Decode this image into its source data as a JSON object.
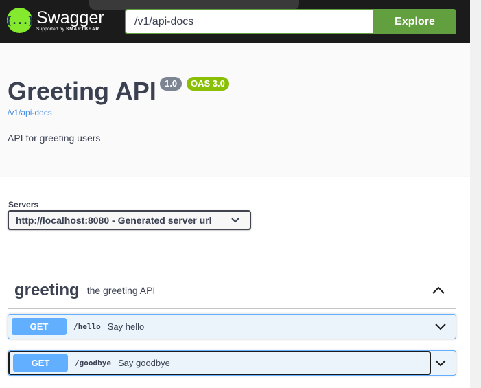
{
  "topbar": {
    "logo_symbol": "{...}",
    "logo_name": "Swagger",
    "logo_sub_prefix": "Supported by",
    "logo_sub_brand": "SMARTBEAR",
    "url_value": "/v1/api-docs",
    "explore_label": "Explore",
    "brand_color": "#85ea2d",
    "accent_color": "#62a03f"
  },
  "info": {
    "title": "Greeting API",
    "version": "1.0",
    "oas": "OAS 3.0",
    "spec_link": "/v1/api-docs",
    "description": "API for greeting users"
  },
  "servers": {
    "label": "Servers",
    "selected": "http://localhost:8080 - Generated server url",
    "icon": "chevron-down-icon"
  },
  "tag": {
    "name": "greeting",
    "description": "the greeting API",
    "icon": "chevron-up-icon",
    "operations": [
      {
        "method": "GET",
        "path": "/hello",
        "summary": "Say hello",
        "icon": "chevron-down-icon"
      },
      {
        "method": "GET",
        "path": "/goodbye",
        "summary": "Say goodbye",
        "icon": "chevron-down-icon"
      }
    ]
  },
  "colors": {
    "get_method": "#61affe",
    "get_bg": "#ebf3fb",
    "version_badge": "#7d8492",
    "oas_badge": "#89bf04"
  }
}
